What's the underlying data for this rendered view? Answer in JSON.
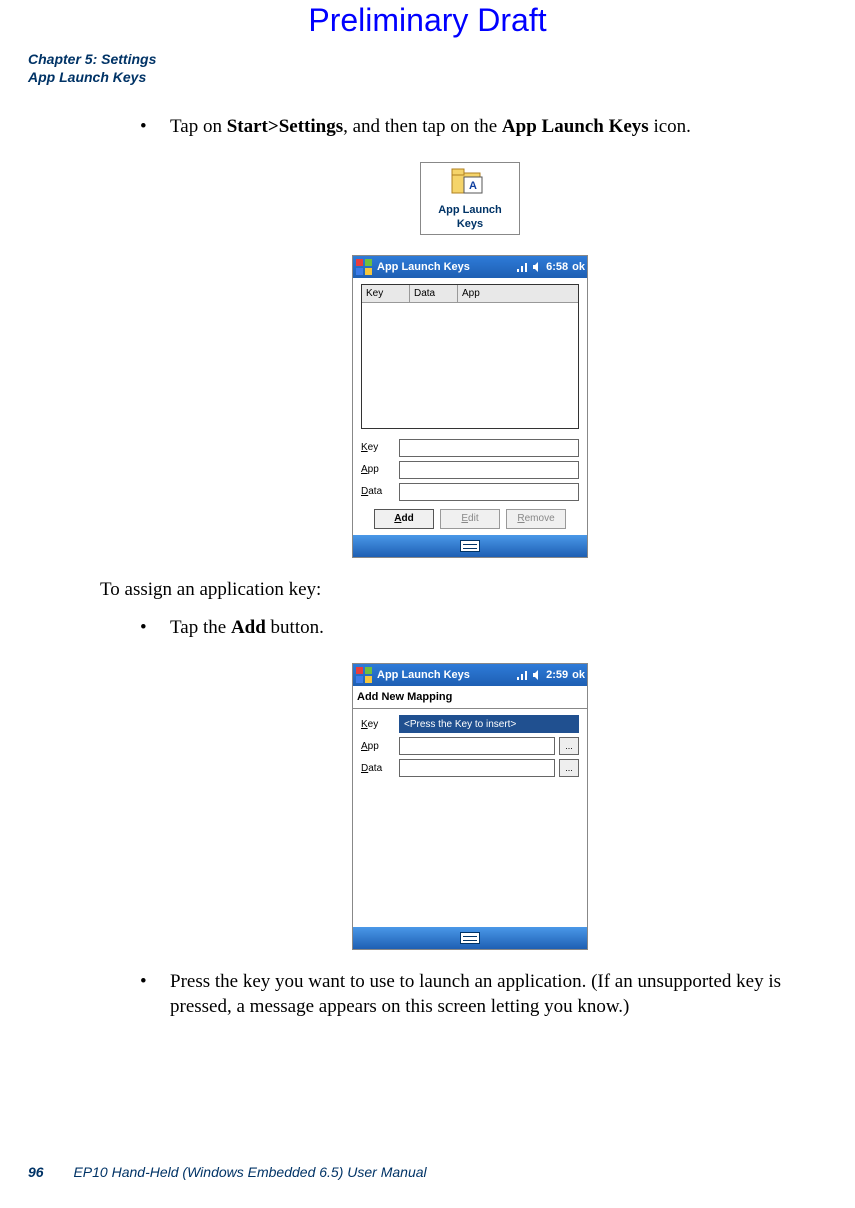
{
  "watermark": "Preliminary Draft",
  "header": {
    "line1": "Chapter 5: Settings",
    "line2": "App Launch Keys"
  },
  "body": {
    "step1_prefix": "Tap on ",
    "step1_bold1": "Start>Settings",
    "step1_mid": ", and then tap on the ",
    "step1_bold2": "App Launch Keys",
    "step1_suffix": " icon.",
    "assign_intro": "To assign an application key:",
    "step2_prefix": "Tap the ",
    "step2_bold": "Add",
    "step2_suffix": " button.",
    "step3": "Press the key you want to use to launch an application. (If an unsupported key is pressed, a message appears on this screen letting you know.)"
  },
  "icon_badge": {
    "line1": "App Launch",
    "line2": "Keys"
  },
  "screen1": {
    "title": "App Launch Keys",
    "time": "6:58",
    "ok": "ok",
    "col_key": "Key",
    "col_data": "Data",
    "col_app": "App",
    "lbl_key": "Key",
    "lbl_app": "App",
    "lbl_data": "Data",
    "key_u": "K",
    "app_u": "A",
    "data_u": "D",
    "btn_add": "Add",
    "btn_add_u": "A",
    "btn_edit": "Edit",
    "btn_edit_u": "E",
    "btn_remove": "Remove",
    "btn_remove_u": "R"
  },
  "screen2": {
    "title": "App Launch Keys",
    "time": "2:59",
    "ok": "ok",
    "section": "Add New Mapping",
    "lbl_key": "Key",
    "lbl_app": "App",
    "lbl_data": "Data",
    "key_u": "K",
    "app_u": "A",
    "data_u": "D",
    "key_value": "<Press the Key to insert>",
    "browse": "..."
  },
  "footer": {
    "page": "96",
    "manual": "EP10 Hand-Held (Windows Embedded 6.5) User Manual"
  }
}
